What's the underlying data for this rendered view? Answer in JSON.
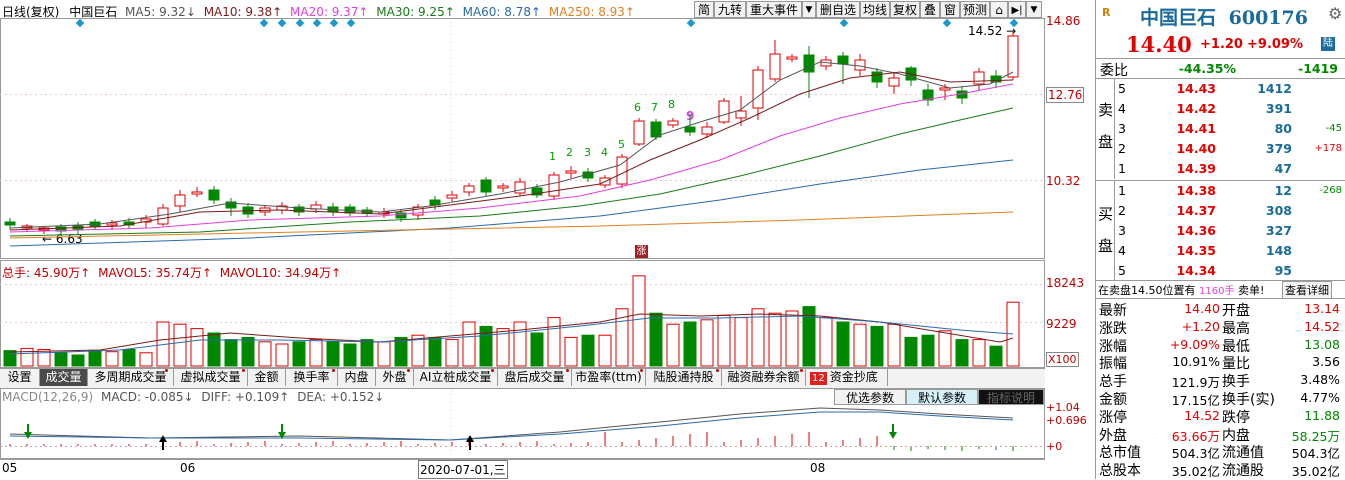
{
  "toolbar": {
    "ma_label": "日线(复权)",
    "stock_name": "中国巨石",
    "ma5": "MA5: 9.32↓",
    "ma10": "MA10: 9.38↑",
    "ma20": "MA20: 9.37↑",
    "ma30": "MA30: 9.25↑",
    "ma60": "MA60: 8.78↑",
    "ma250": "MA250: 8.93↑",
    "buttons": [
      "简",
      "九转",
      "重大事件",
      "▼",
      "删自选",
      "均线",
      "复权",
      "叠",
      "窗",
      "预测",
      "⌂",
      "▶|",
      "▼"
    ]
  },
  "price_axis": {
    "high": "14.86",
    "mid": "12.76",
    "low": "10.32",
    "high_mark": "14.52",
    "low_mark": "6.63"
  },
  "nine_turn": [
    "1",
    "2",
    "3",
    "4",
    "5",
    "6",
    "7",
    "8",
    "9"
  ],
  "limit_badge": "涨",
  "volume": {
    "label": "总手: 45.90万↑",
    "mavol5": "MAVOL5: 35.74万↑",
    "mavol10": "MAVOL10: 34.94万↑",
    "axis_top": "18243",
    "axis_mid": "9229",
    "axis_unit": "X100"
  },
  "tabs": [
    "设置",
    "成交量",
    "多周期成交量",
    "虚拟成交量",
    "金额",
    "换手率",
    "内盘",
    "外盘",
    "AI立桩成交量",
    "盘后成交量",
    "市盈率(ttm)",
    "陆股通持股",
    "融资融券余额",
    "12",
    "资金抄底"
  ],
  "macd": {
    "label": "MACD(12,26,9)",
    "macd_val": "MACD: -0.085↓",
    "diff": "DIFF: +0.109↑",
    "dea": "DEA: +0.152↓",
    "btn_opt": "优选参数",
    "btn_default": "默认参数",
    "btn_help": "指标说明",
    "axis1": "+1.04",
    "axis2": "+0.696",
    "axis3": "+0"
  },
  "date_axis": {
    "d1": "05",
    "d2": "06",
    "d3": "2020-07-01,三",
    "d4": "08"
  },
  "quote": {
    "logo": "R",
    "name": "中国巨石",
    "code": "600176",
    "price": "14.40",
    "change": "+1.20",
    "pct": "+9.09%",
    "tag": "陆",
    "weibi_label": "委比",
    "weibi_pct": "-44.35%",
    "weibi_diff": "-1419",
    "sell_label": [
      "卖",
      "盘"
    ],
    "buy_label": [
      "买",
      "盘"
    ],
    "sell": [
      {
        "lvl": "5",
        "price": "14.43",
        "vol": "1412",
        "chg": ""
      },
      {
        "lvl": "4",
        "price": "14.42",
        "vol": "391",
        "chg": ""
      },
      {
        "lvl": "3",
        "price": "14.41",
        "vol": "80",
        "chg": "-45"
      },
      {
        "lvl": "2",
        "price": "14.40",
        "vol": "379",
        "chg": "+178"
      },
      {
        "lvl": "1",
        "price": "14.39",
        "vol": "47",
        "chg": ""
      }
    ],
    "buy": [
      {
        "lvl": "1",
        "price": "14.38",
        "vol": "12",
        "chg": "-268"
      },
      {
        "lvl": "2",
        "price": "14.37",
        "vol": "308",
        "chg": ""
      },
      {
        "lvl": "3",
        "price": "14.36",
        "vol": "327",
        "chg": ""
      },
      {
        "lvl": "4",
        "price": "14.35",
        "vol": "148",
        "chg": ""
      },
      {
        "lvl": "5",
        "price": "14.34",
        "vol": "95",
        "chg": ""
      }
    ],
    "notice_a": "在卖盘14.50位置有",
    "notice_b": "1160手",
    "notice_c": "卖单!",
    "notice_link": "查看详细",
    "stats": [
      {
        "l1": "最新",
        "v1": "14.40",
        "l2": "开盘",
        "v2": "13.14"
      },
      {
        "l1": "涨跌",
        "v1": "+1.20",
        "l2": "最高",
        "v2": "14.52"
      },
      {
        "l1": "涨幅",
        "v1": "+9.09%",
        "l2": "最低",
        "v2": "13.08"
      },
      {
        "l1": "振幅",
        "v1": "10.91%",
        "l2": "量比",
        "v2": "3.56"
      },
      {
        "l1": "总手",
        "v1": "121.9万",
        "l2": "换手",
        "v2": "3.48%"
      },
      {
        "l1": "金额",
        "v1": "17.15亿",
        "l2": "换手(实)",
        "v2": "4.77%"
      },
      {
        "l1": "涨停",
        "v1": "14.52",
        "l2": "跌停",
        "v2": "11.88"
      },
      {
        "l1": "外盘",
        "v1": "63.66万",
        "l2": "内盘",
        "v2": "58.25万"
      },
      {
        "l1": "总市值",
        "v1": "504.3亿",
        "l2": "流通值",
        "v2": "504.3亿"
      },
      {
        "l1": "总股本",
        "v1": "35.02亿",
        "l2": "流通股",
        "v2": "35.02亿"
      }
    ]
  },
  "colors": {
    "up": "#e00000",
    "down": "#008800",
    "ma5": "#555555",
    "ma10": "#7a1a1a",
    "ma20": "#e040e0",
    "ma30": "#1a7a1a",
    "ma60": "#2a6aaa",
    "ma250": "#e08020"
  }
}
